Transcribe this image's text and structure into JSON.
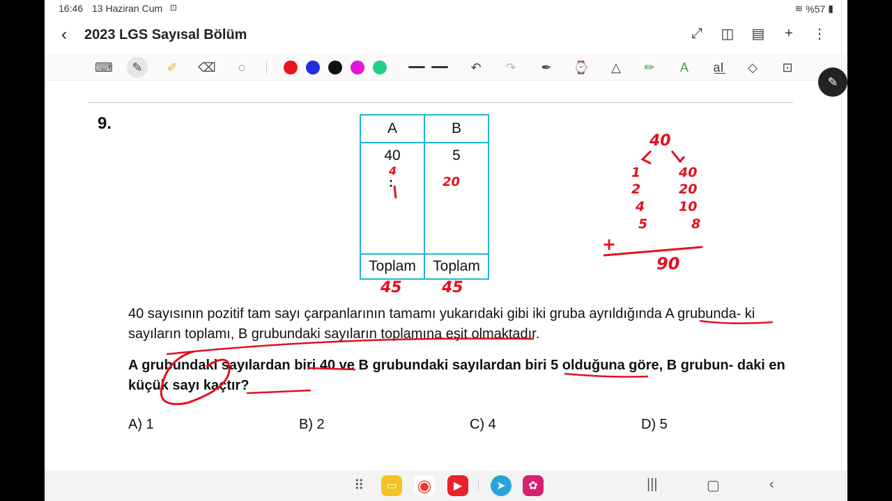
{
  "status": {
    "time": "16:46",
    "date": "13 Haziran Cum",
    "battery": "%57"
  },
  "app": {
    "title": "2023 LGS Sayısal Bölüm"
  },
  "toolbar": {
    "colors": [
      "#e8141f",
      "#1f2fe0",
      "#111111",
      "#e215d8",
      "#22d08a"
    ]
  },
  "question": {
    "number": "9.",
    "table": {
      "headers": [
        "A",
        "B"
      ],
      "values": [
        "40",
        "5"
      ],
      "footers": [
        "Toplam",
        "Toplam"
      ]
    },
    "paragraph": "40 sayısının pozitif tam sayı çarpanlarının tamamı yukarıdaki gibi iki gruba ayrıldığında A grubunda- ki sayıların toplamı, B grubundaki sayıların toplamına eşit olmaktadır.",
    "prompt": "A grubundaki sayılardan biri 40 ve B grubundaki sayılardan biri 5 olduğuna göre, B grubun- daki en küçük sayı kaçtır?",
    "options": [
      "A) 1",
      "B) 2",
      "C) 4",
      "D) 5"
    ]
  },
  "annotations": {
    "sum_a": "45",
    "sum_b": "45",
    "col_a_note": "4",
    "col_b_note": "20",
    "top": "40",
    "left_col": [
      "1",
      "2",
      "4",
      "5"
    ],
    "right_col": [
      "40",
      "20",
      "10",
      "8"
    ],
    "plus": "+",
    "total": "90"
  }
}
